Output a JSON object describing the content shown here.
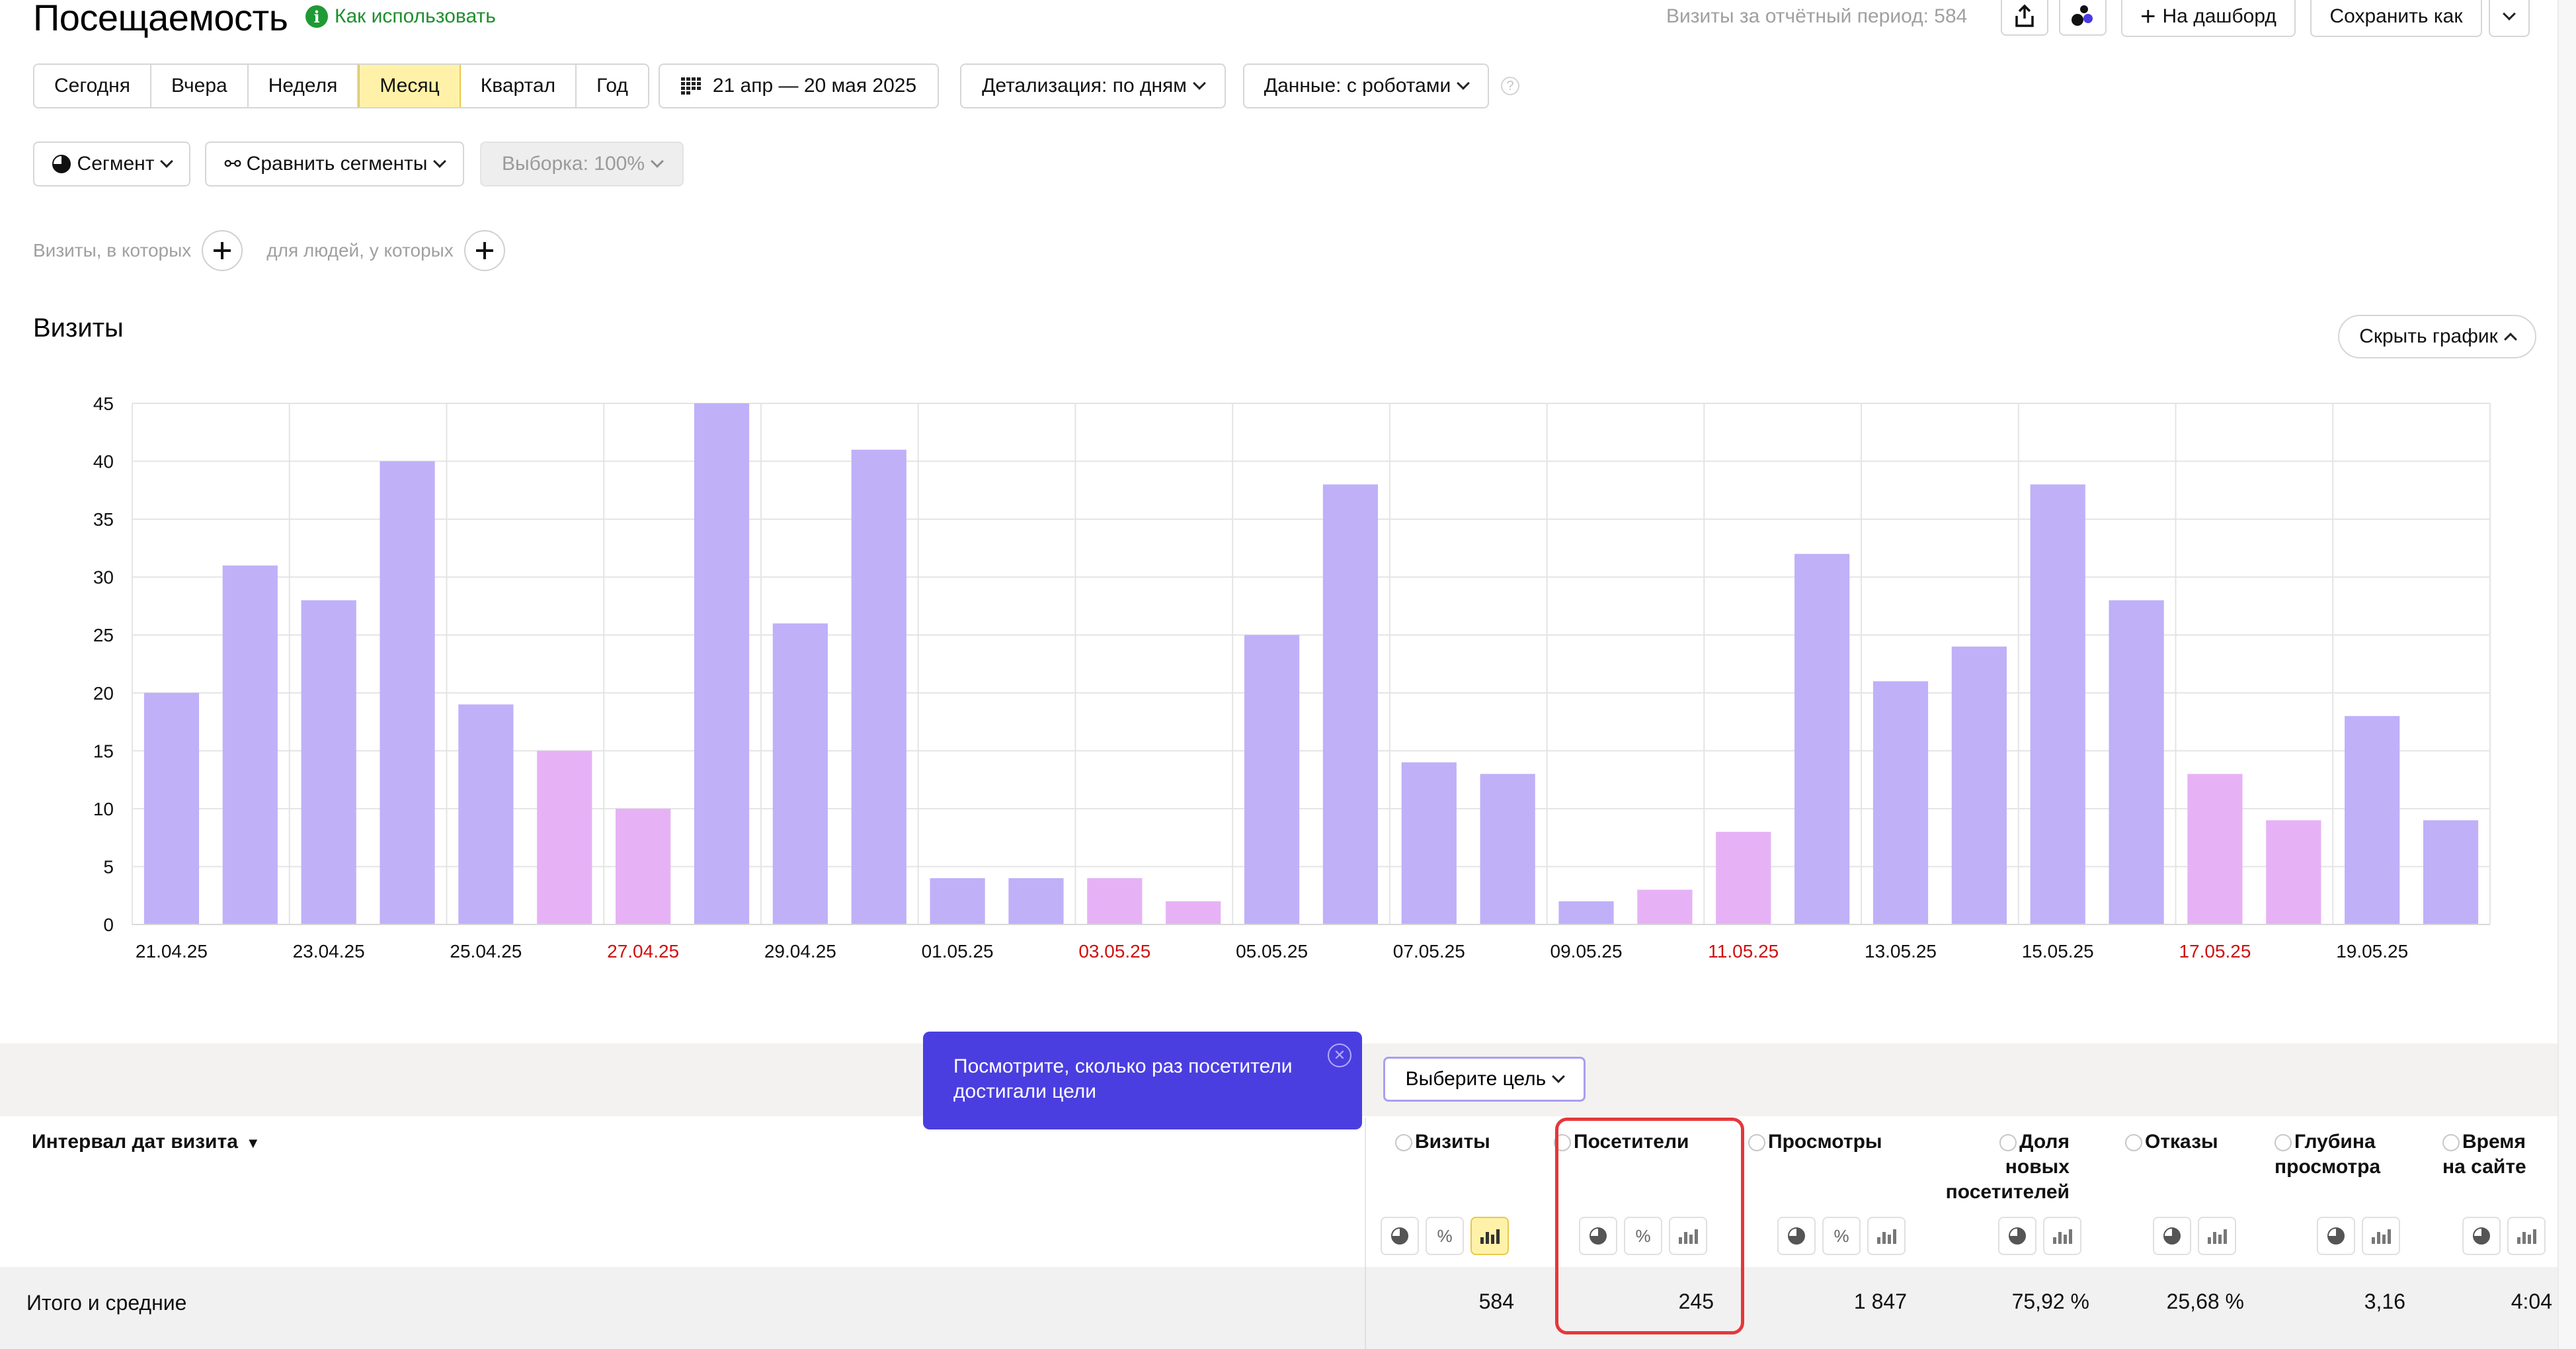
{
  "header": {
    "title": "Посещаемость",
    "help_link": "Как использовать",
    "help_icon": "info-icon",
    "visits_period": "Визиты за отчётный период: 584",
    "add_dashboard": "На дашборд",
    "save_as": "Сохранить как"
  },
  "periods": [
    "Сегодня",
    "Вчера",
    "Неделя",
    "Месяц",
    "Квартал",
    "Год"
  ],
  "active_period": "Месяц",
  "date_range": "21 апр — 20 мая 2025",
  "detail": "Детализация: по дням",
  "data_mode": "Данные: с роботами",
  "segment": "Сегмент",
  "compare": "Сравнить сегменты",
  "sample": "Выборка: 100%",
  "filters": {
    "visits_label": "Визиты, в которых",
    "people_label": "для людей, у которых"
  },
  "chart_section": {
    "title": "Визиты",
    "hide_button": "Скрыть график"
  },
  "chart_data": {
    "type": "bar",
    "title": "Визиты",
    "ylim": [
      0,
      45
    ],
    "yticks": [
      "0",
      "5",
      "10",
      "15",
      "20",
      "25",
      "30",
      "35",
      "40",
      "45"
    ],
    "grid": true,
    "colors": {
      "weekday": "#c0b0f8",
      "weekend": "#e6b2f5",
      "weekend_label": "#d01010"
    },
    "categories": [
      "21.04.25",
      "22.04.25",
      "23.04.25",
      "24.04.25",
      "25.04.25",
      "26.04.25",
      "27.04.25",
      "28.04.25",
      "29.04.25",
      "30.04.25",
      "01.05.25",
      "02.05.25",
      "03.05.25",
      "04.05.25",
      "05.05.25",
      "06.05.25",
      "07.05.25",
      "08.05.25",
      "09.05.25",
      "10.05.25",
      "11.05.25",
      "12.05.25",
      "13.05.25",
      "14.05.25",
      "15.05.25",
      "16.05.25",
      "17.05.25",
      "18.05.25",
      "19.05.25",
      "20.05.25"
    ],
    "values": [
      20,
      31,
      28,
      40,
      19,
      15,
      10,
      45,
      26,
      41,
      4,
      4,
      4,
      2,
      25,
      38,
      14,
      13,
      2,
      3,
      8,
      32,
      21,
      24,
      38,
      28,
      13,
      9,
      18,
      9
    ],
    "weekend": [
      false,
      false,
      false,
      false,
      false,
      true,
      true,
      false,
      false,
      false,
      false,
      false,
      true,
      true,
      false,
      false,
      false,
      false,
      false,
      true,
      true,
      false,
      false,
      false,
      false,
      false,
      true,
      true,
      false,
      false
    ],
    "xtick_labels": [
      "21.04.25",
      "23.04.25",
      "25.04.25",
      "27.04.25",
      "29.04.25",
      "01.05.25",
      "03.05.25",
      "05.05.25",
      "07.05.25",
      "09.05.25",
      "11.05.25",
      "13.05.25",
      "15.05.25",
      "17.05.25",
      "19.05.25"
    ]
  },
  "tooltip": {
    "text": "Посмотрите, сколько раз посетители достигали цели"
  },
  "goal_select": "Выберите цель",
  "table": {
    "dimension_header": "Интервал дат визита",
    "sort_indicator": "▼",
    "columns": [
      {
        "title": "Визиты",
        "total": "584"
      },
      {
        "title": "Посетители",
        "total": "245"
      },
      {
        "title": "Просмотры",
        "total": "1 847"
      },
      {
        "title": "Доля новых посетителей",
        "total": "75,92 %"
      },
      {
        "title": "Отказы",
        "total": "25,68 %"
      },
      {
        "title": "Глубина просмотра",
        "total": "3,16"
      },
      {
        "title": "Время на сайте",
        "total": "4:04"
      }
    ],
    "totals_label": "Итого и средние"
  }
}
